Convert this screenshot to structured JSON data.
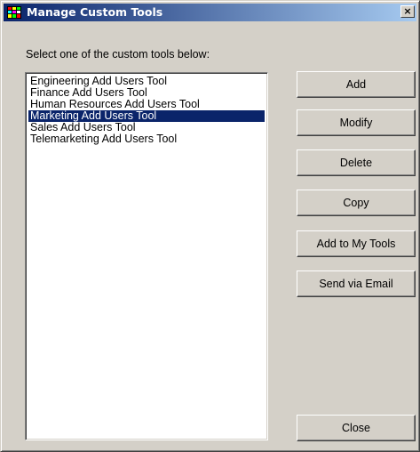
{
  "window": {
    "title": "Manage Custom Tools",
    "close_glyph": "×",
    "icon": "app-icon"
  },
  "instruction": "Select one of the custom tools below:",
  "tools": [
    {
      "label": "Engineering Add Users Tool",
      "selected": false
    },
    {
      "label": "Finance Add Users Tool",
      "selected": false
    },
    {
      "label": "Human Resources Add Users Tool",
      "selected": false
    },
    {
      "label": "Marketing Add Users Tool",
      "selected": true
    },
    {
      "label": "Sales Add Users Tool",
      "selected": false
    },
    {
      "label": "Telemarketing Add Users Tool",
      "selected": false
    }
  ],
  "buttons": {
    "add": "Add",
    "modify": "Modify",
    "delete": "Delete",
    "copy": "Copy",
    "add_to_my_tools": "Add to My Tools",
    "send_via_email": "Send via Email",
    "close": "Close"
  },
  "colors": {
    "title_gradient_start": "#0a246a",
    "title_gradient_end": "#a6caf0",
    "selection": "#0a246a",
    "face": "#d4d0c8"
  }
}
